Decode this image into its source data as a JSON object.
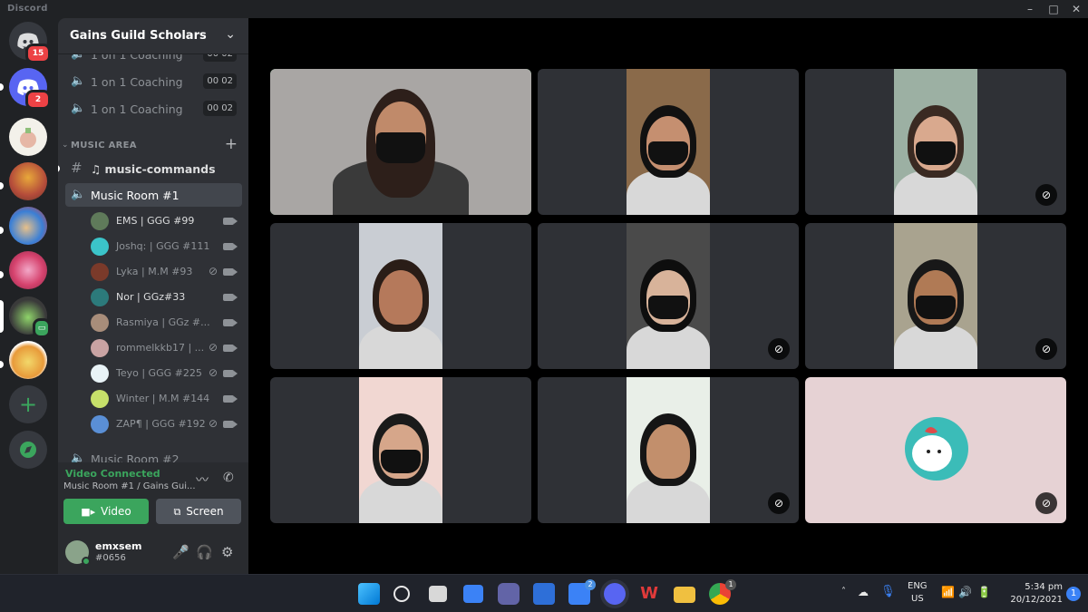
{
  "window": {
    "app_title": "Discord",
    "controls": [
      "–",
      "□",
      "✕"
    ]
  },
  "rail": {
    "dm_badge": "15",
    "discord_badge": "2",
    "add_server": "+",
    "explore_icon": "compass-icon"
  },
  "guild": {
    "name": "Gains Guild Scholars",
    "chevron": "⌵"
  },
  "channels": {
    "coaching": [
      {
        "label": "1 on 1 Coaching",
        "count": "00 02"
      },
      {
        "label": "1 on 1 Coaching",
        "count": "00 02"
      },
      {
        "label": "1 on 1 Coaching",
        "count": "00 02"
      }
    ],
    "category": "MUSIC AREA",
    "text_channel": "♫ music-commands",
    "active_voice": "Music Room #1",
    "next_voice": "Music Room #2"
  },
  "members": [
    {
      "name": "EMS | GGG #99",
      "color": "#5f7a5a",
      "muted": false,
      "bright": true
    },
    {
      "name": "Joshq: | GGG #111",
      "color": "#3bc4c9",
      "muted": false,
      "bright": false
    },
    {
      "name": "Lyka | M.M #93",
      "color": "#7a3a2a",
      "muted": true,
      "bright": false
    },
    {
      "name": "Nor | GGz#33",
      "color": "#2c7a7b",
      "muted": false,
      "bright": true
    },
    {
      "name": "Rasmiya | GGz #...",
      "color": "#a88d7a",
      "muted": false,
      "bright": false
    },
    {
      "name": "rommelkkb17 | ...",
      "color": "#c9a3a3",
      "muted": true,
      "bright": false
    },
    {
      "name": "Teyo | GGG #225",
      "color": "#e9f3f7",
      "muted": true,
      "bright": false
    },
    {
      "name": "Winter | M.M #144",
      "color": "#c6e06a",
      "muted": false,
      "bright": false
    },
    {
      "name": "ZAP¶ | GGG #192",
      "color": "#5a8fd6",
      "muted": true,
      "bright": false
    }
  ],
  "voice_panel": {
    "status": "Video Connected",
    "subtitle": "Music Room #1 / Gains Gui...",
    "video_label": "Video",
    "screen_label": "Screen"
  },
  "user": {
    "name": "emxsem",
    "tag": "#0656"
  },
  "video_tiles": [
    {
      "bg": "#8d8a88",
      "feed": "#a9a6a4",
      "skin": "#c08a6a",
      "hair": "#2d1f1a",
      "mask": true,
      "speaking": true,
      "muted": false
    },
    {
      "bg": "#2f3136",
      "feed": "#8a6a4a",
      "skin": "#c58f70",
      "hair": "#111",
      "mask": true,
      "speaking": false,
      "muted": false
    },
    {
      "bg": "#2f3136",
      "feed": "#9cb0a3",
      "skin": "#d9a98e",
      "hair": "#3a2a22",
      "mask": true,
      "speaking": false,
      "muted": true
    },
    {
      "bg": "#2f3136",
      "feed": "#c9cdd3",
      "skin": "#b5795b",
      "hair": "#2a1d17",
      "mask": false,
      "speaking": false,
      "muted": false
    },
    {
      "bg": "#2f3136",
      "feed": "#4a4a4a",
      "skin": "#d8b39a",
      "hair": "#0e0e0e",
      "mask": true,
      "speaking": false,
      "muted": true
    },
    {
      "bg": "#2f3136",
      "feed": "#a9a38f",
      "skin": "#b07a55",
      "hair": "#181818",
      "mask": true,
      "speaking": false,
      "muted": true
    },
    {
      "bg": "#2f3136",
      "feed": "#f1d7d2",
      "skin": "#d6a68a",
      "hair": "#1a1a1a",
      "mask": true,
      "speaking": false,
      "muted": false
    },
    {
      "bg": "#2f3136",
      "feed": "#e9efe8",
      "skin": "#c28f6c",
      "hair": "#151515",
      "mask": false,
      "speaking": false,
      "muted": true
    },
    {
      "bg": "#e6d2d4",
      "feed": "#e6d2d4",
      "avatar": true,
      "speaking": false,
      "muted": true
    }
  ],
  "taskbar": {
    "lang": "ENG",
    "region": "US",
    "time": "5:34 pm",
    "date": "20/12/2021",
    "notifications": "1",
    "mail_badge": "2",
    "chrome_badge": "1",
    "tray_arrow": "˄"
  },
  "colors": {
    "accent_green": "#3ba55d",
    "badge_red": "#ed4245",
    "sidebar": "#2f3136",
    "rail": "#202225"
  }
}
